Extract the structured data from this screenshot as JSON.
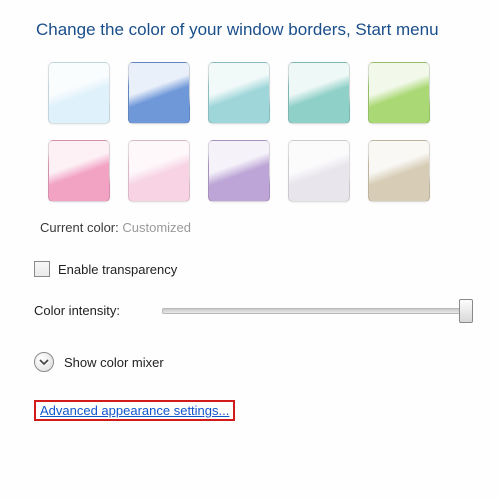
{
  "heading": "Change the color of your window borders, Start menu",
  "colors": [
    "#dff1fb",
    "#6f98d9",
    "#9ed6d9",
    "#8fd0c8",
    "#aad874",
    "#f2a3c4",
    "#f7d3e4",
    "#bda6d7",
    "#e9e5ec",
    "#d7cdb6"
  ],
  "current": {
    "label": "Current color:",
    "value": "Customized"
  },
  "transparency": {
    "label": "Enable transparency",
    "checked": false
  },
  "intensity": {
    "label": "Color intensity:"
  },
  "mixer": {
    "label": "Show color mixer"
  },
  "advanced_link": "Advanced appearance settings..."
}
